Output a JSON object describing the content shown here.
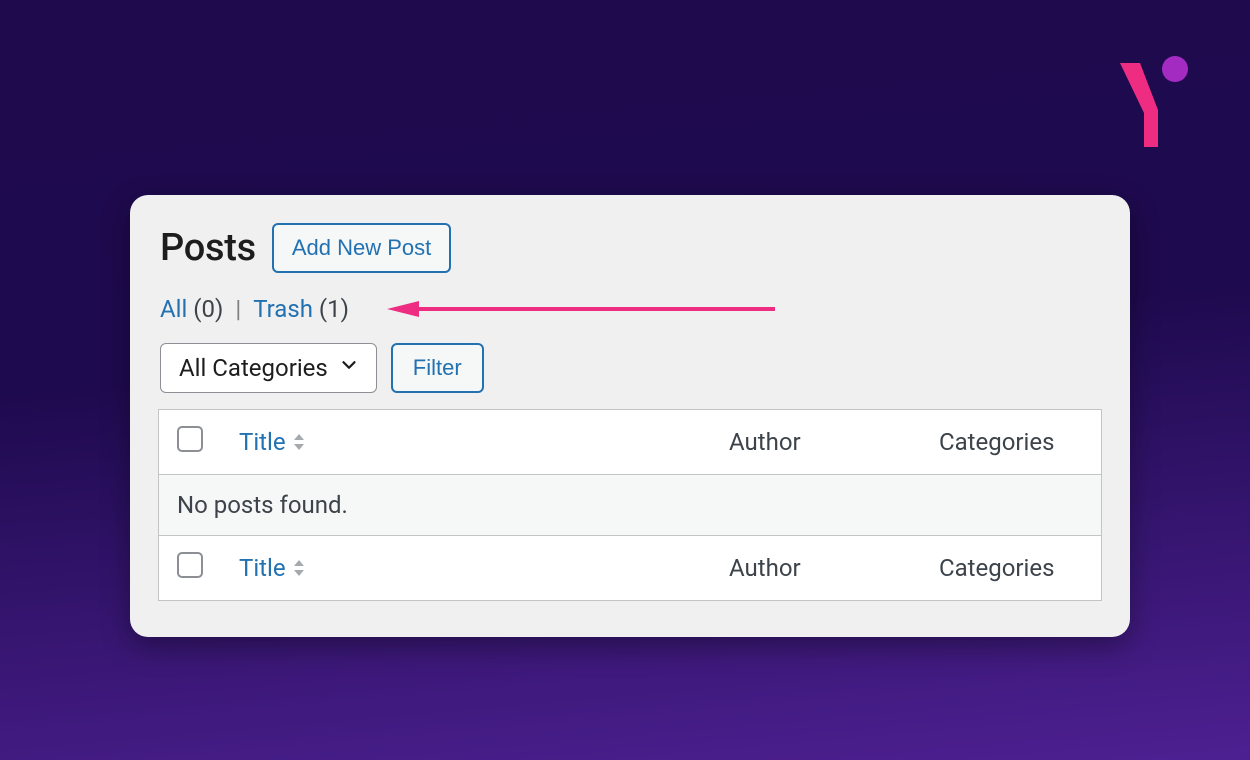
{
  "header": {
    "title": "Posts",
    "add_new_label": "Add New Post"
  },
  "status_filters": {
    "all_label": "All",
    "all_count": "(0)",
    "separator": "|",
    "trash_label": "Trash",
    "trash_count": "(1)"
  },
  "controls": {
    "category_select": "All Categories",
    "filter_label": "Filter"
  },
  "table": {
    "columns": {
      "title": "Title",
      "author": "Author",
      "categories": "Categories"
    },
    "empty_message": "No posts found."
  },
  "brand": {
    "accent_pink": "#ee2d82",
    "accent_purple": "#a32bc1"
  }
}
